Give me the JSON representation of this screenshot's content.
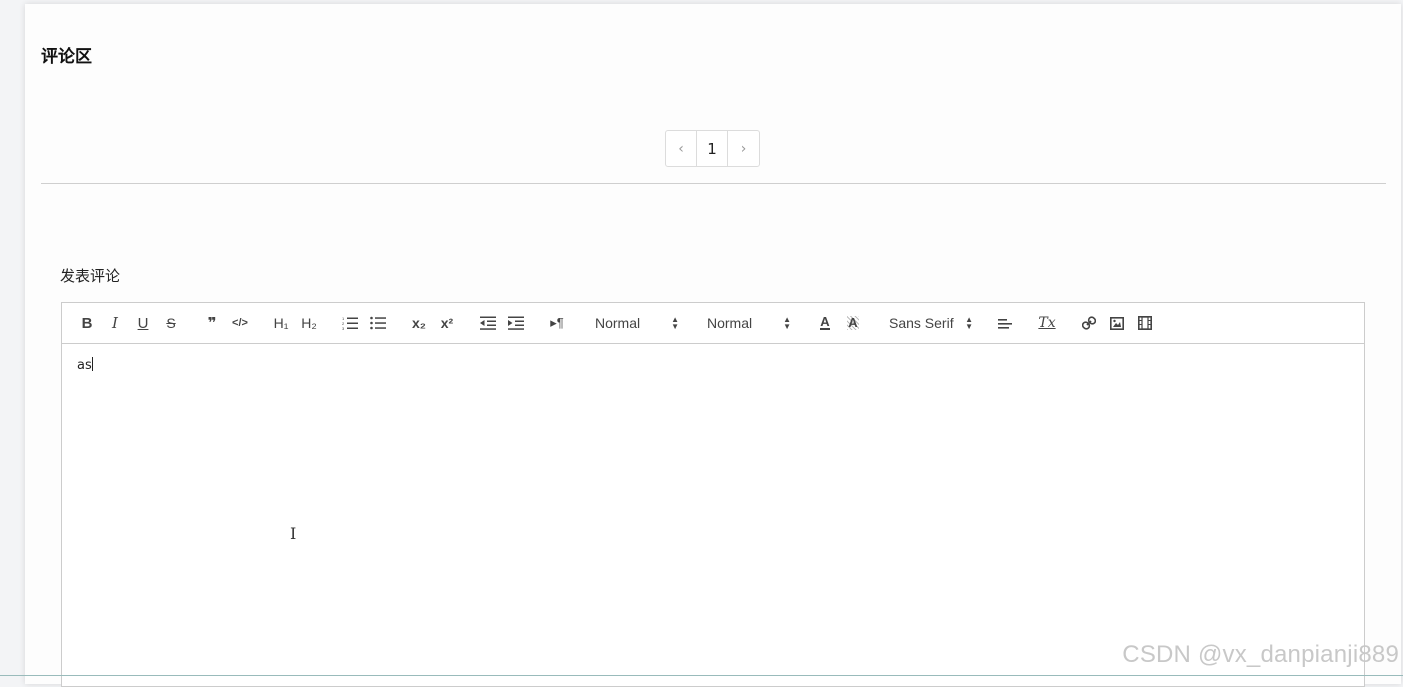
{
  "comments": {
    "title": "评论区"
  },
  "pagination": {
    "prev": "‹",
    "current": "1",
    "next": "›"
  },
  "post": {
    "label": "发表评论"
  },
  "toolbar": {
    "bold": "B",
    "italic": "I",
    "underline": "U",
    "strike": "S",
    "blockquote": "❞",
    "code": "</>",
    "h1": "H₁",
    "h2": "H₂",
    "ordered_list": "ordered-list-icon",
    "bullet_list": "bullet-list-icon",
    "subscript": "x₂",
    "superscript": "x²",
    "outdent": "outdent-icon",
    "indent": "indent-icon",
    "direction": "▸¶",
    "size_value": "Normal",
    "header_value": "Normal",
    "color": "A",
    "background": "A",
    "font_value": "Sans Serif",
    "align": "align-icon",
    "clean": "Tx",
    "link": "link-icon",
    "image": "image-icon",
    "video": "video-icon"
  },
  "editor": {
    "content": "as"
  },
  "watermark": "CSDN @vx_danpianji889"
}
